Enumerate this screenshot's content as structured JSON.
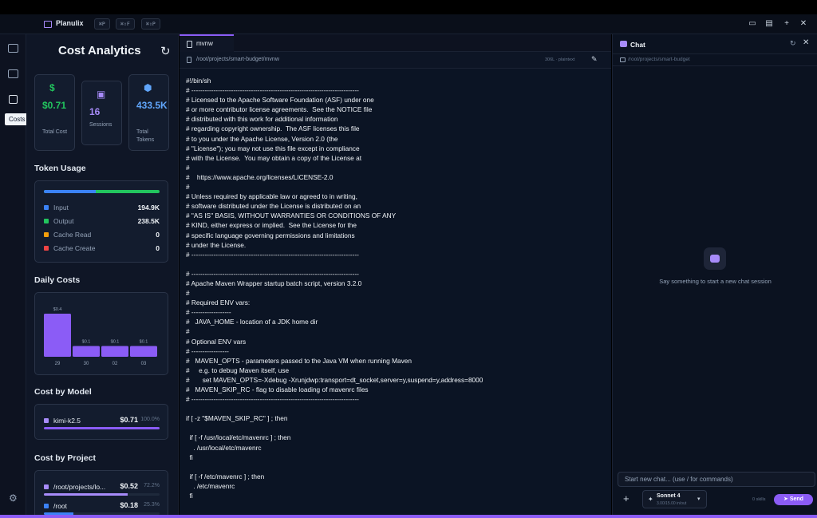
{
  "app": {
    "name": "Planulix"
  },
  "titlebar": {
    "shortcuts": [
      "⌘P",
      "⌘⇧F",
      "⌘⇧P"
    ]
  },
  "rail": {
    "tooltip": "Costs"
  },
  "costs": {
    "title": "Cost Analytics",
    "stats": [
      {
        "value": "$0.71",
        "label": "Total Cost",
        "color": "#22c55e"
      },
      {
        "value": "16",
        "label": "Sessions",
        "color": "#a78bfa"
      },
      {
        "value": "433.5K",
        "label": "Total Tokens",
        "color": "#60a5fa"
      }
    ],
    "token_usage": {
      "title": "Token Usage",
      "input_fraction": 0.45,
      "rows": [
        {
          "label": "Input",
          "value": "194.9K",
          "color": "#3b82f6"
        },
        {
          "label": "Output",
          "value": "238.5K",
          "color": "#22c55e"
        },
        {
          "label": "Cache Read",
          "value": "0",
          "color": "#f59e0b"
        },
        {
          "label": "Cache Create",
          "value": "0",
          "color": "#ef4444"
        }
      ]
    },
    "daily_costs": {
      "title": "Daily Costs"
    },
    "cost_by_model": {
      "title": "Cost by Model",
      "rows": [
        {
          "name": "kimi-k2.5",
          "cost": "$0.71",
          "pct": "100.0%",
          "fraction": 1.0
        }
      ]
    },
    "cost_by_project": {
      "title": "Cost by Project",
      "rows": [
        {
          "name": "/root/projects/lo...",
          "cost": "$0.52",
          "pct": "72.2%",
          "fraction": 0.722,
          "color": "#a78bfa"
        },
        {
          "name": "/root",
          "cost": "$0.18",
          "pct": "25.3%",
          "fraction": 0.253,
          "color": "#3b82f6"
        }
      ]
    }
  },
  "chart_data": {
    "type": "bar",
    "categories": [
      "29",
      "30",
      "02",
      "03"
    ],
    "values": [
      0.4,
      0.1,
      0.1,
      0.1
    ],
    "labels": [
      "$0.4",
      "$0.1",
      "$0.1",
      "$0.1"
    ],
    "ylim": [
      0,
      0.4
    ],
    "color": "#8b5cf6"
  },
  "editor": {
    "tab": "mvnw",
    "path": "/root/projects/smart-budget/mvnw",
    "meta": "306L · plaintext",
    "code": "#!/bin/sh\n# ----------------------------------------------------------------------------\n# Licensed to the Apache Software Foundation (ASF) under one\n# or more contributor license agreements.  See the NOTICE file\n# distributed with this work for additional information\n# regarding copyright ownership.  The ASF licenses this file\n# to you under the Apache License, Version 2.0 (the\n# \"License\"); you may not use this file except in compliance\n# with the License.  You may obtain a copy of the License at\n#\n#    https://www.apache.org/licenses/LICENSE-2.0\n#\n# Unless required by applicable law or agreed to in writing,\n# software distributed under the License is distributed on an\n# \"AS IS\" BASIS, WITHOUT WARRANTIES OR CONDITIONS OF ANY\n# KIND, either express or implied.  See the License for the\n# specific language governing permissions and limitations\n# under the License.\n# ----------------------------------------------------------------------------\n\n# ----------------------------------------------------------------------------\n# Apache Maven Wrapper startup batch script, version 3.2.0\n#\n# Required ENV vars:\n# ------------------\n#   JAVA_HOME - location of a JDK home dir\n#\n# Optional ENV vars\n# -----------------\n#   MAVEN_OPTS - parameters passed to the Java VM when running Maven\n#     e.g. to debug Maven itself, use\n#       set MAVEN_OPTS=-Xdebug -Xrunjdwp:transport=dt_socket,server=y,suspend=y,address=8000\n#   MAVEN_SKIP_RC - flag to disable loading of mavenrc files\n# ----------------------------------------------------------------------------\n\nif [ -z \"$MAVEN_SKIP_RC\" ] ; then\n\n  if [ -f /usr/local/etc/mavenrc ] ; then\n    . /usr/local/etc/mavenrc\n  fi\n\n  if [ -f /etc/mavenrc ] ; then\n    . /etc/mavenrc\n  fi"
  },
  "chat": {
    "title": "Chat",
    "path": "/root/projects/smart-budget",
    "empty_message": "Say something to start a new chat session",
    "input_placeholder": "Start new chat... (use / for commands)",
    "model_name": "Sonnet 4",
    "model_price": "3.00/15.00 in/out",
    "stats": "0 skills",
    "send_label": "Send"
  }
}
